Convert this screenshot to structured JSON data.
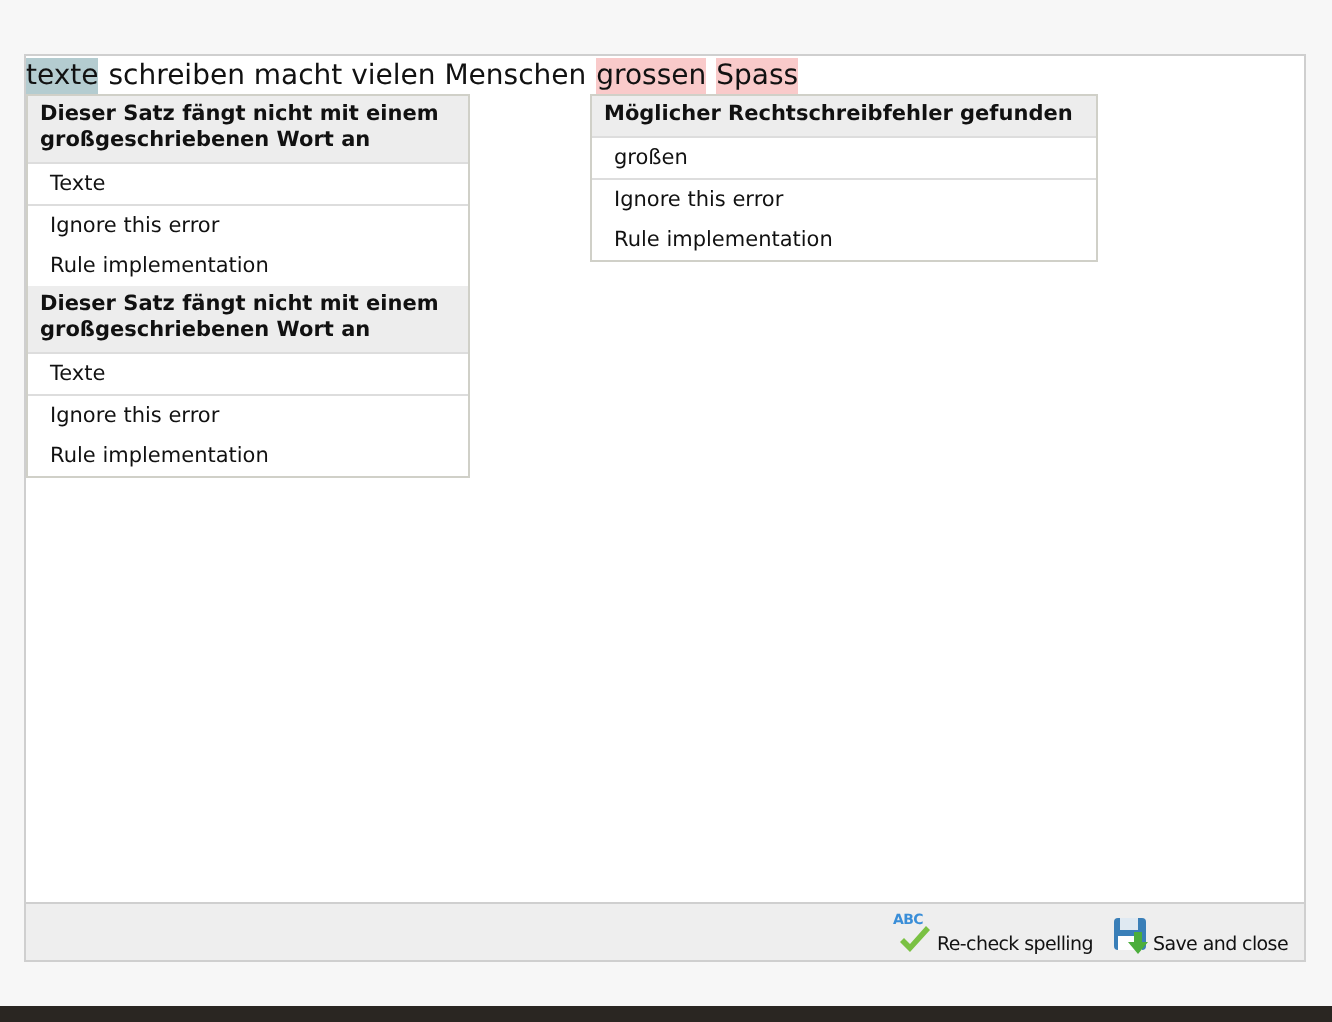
{
  "text_segments": [
    {
      "text": "texte",
      "kind": "grammar"
    },
    {
      "text": "schreiben macht vielen Menschen",
      "kind": "plain"
    },
    {
      "text": "grossen",
      "kind": "spelling"
    },
    {
      "text": "Spass",
      "kind": "spelling"
    }
  ],
  "menus": [
    {
      "sections": [
        {
          "heading": "Dieser Satz fängt nicht mit einem großgeschriebenen Wort an",
          "suggestions": [
            "Texte"
          ],
          "actions": [
            "Ignore this error",
            "Rule implementation"
          ]
        },
        {
          "heading": "Dieser Satz fängt nicht mit einem großgeschriebenen Wort an",
          "suggestions": [
            "Texte"
          ],
          "actions": [
            "Ignore this error",
            "Rule implementation"
          ]
        }
      ]
    },
    {
      "sections": [
        {
          "heading": "Möglicher Rechtschreibfehler gefunden",
          "suggestions": [
            "großen"
          ],
          "actions": [
            "Ignore this error",
            "Rule implementation"
          ]
        }
      ]
    }
  ],
  "toolbar": [
    {
      "kind": "recheck",
      "label": "Re-check spelling",
      "icon_text": "ABC"
    },
    {
      "kind": "save",
      "label": "Save and close"
    }
  ]
}
